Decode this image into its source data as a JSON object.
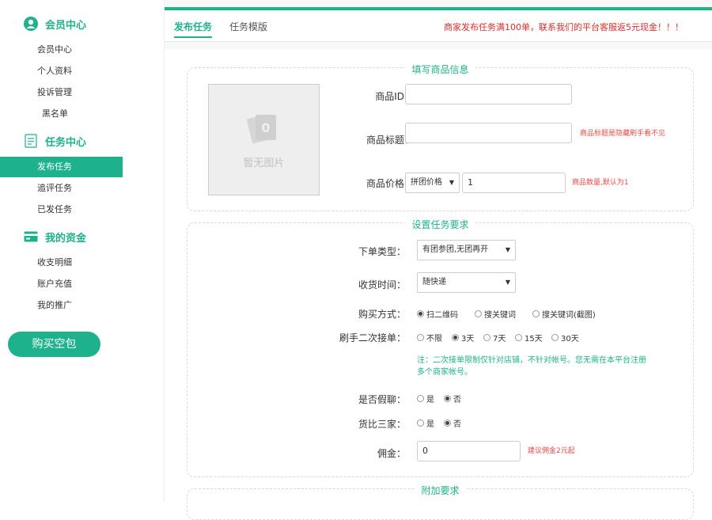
{
  "sidebar": {
    "sections": [
      {
        "title": "会员中心",
        "items": [
          "会员中心",
          "个人资料",
          "投诉管理",
          "黑名单"
        ]
      },
      {
        "title": "任务中心",
        "items": [
          "发布任务",
          "追评任务",
          "已发任务"
        ]
      },
      {
        "title": "我的资金",
        "items": [
          "收支明细",
          "账户充值",
          "我的推广"
        ]
      }
    ],
    "active_item": "发布任务",
    "buy_button": "购买空包"
  },
  "tabs": {
    "publish": "发布任务",
    "template": "任务模版"
  },
  "notice": "商家发布任务满100单，联系我们的平台客服返5元现金！！！",
  "product": {
    "legend": "填写商品信息",
    "no_image": "暂无图片",
    "id_label": "商品ID：",
    "id_value": "",
    "title_label": "商品标题：",
    "title_value": "",
    "title_hint": "商品标题是隐藏刷手看不见",
    "price_label": "商品价格：",
    "price_type": "拼团价格",
    "price_value": "1",
    "price_hint": "商品数量,默认为1"
  },
  "task": {
    "legend": "设置任务要求",
    "order_type_label": "下单类型：",
    "order_type_value": "有团参团,无团再开",
    "receive_label": "收货时间：",
    "receive_value": "随快递",
    "buy_label": "购买方式：",
    "buy_options": [
      "扫二维码",
      "搜关键词",
      "搜关键词(截图)"
    ],
    "buy_selected": 0,
    "second_label": "刷手二次接单：",
    "second_options": [
      "不限",
      "3天",
      "7天",
      "15天",
      "30天"
    ],
    "second_selected": 1,
    "second_note_1": "注：二次接单限制仅针对店铺，不针对帐号。您无需在本平台注册",
    "second_note_2": "多个商家帐号。",
    "fake_chat_label": "是否假聊：",
    "fake_chat_options": [
      "是",
      "否"
    ],
    "fake_chat_selected": 1,
    "compare_label": "货比三家：",
    "compare_options": [
      "是",
      "否"
    ],
    "compare_selected": 1,
    "commission_label": "佣金：",
    "commission_value": "0",
    "commission_hint": "建议佣金2元起"
  },
  "extra": {
    "legend": "附加要求"
  },
  "colors": {
    "accent": "#1db28b",
    "alert": "#e02b2b"
  },
  "icons": [
    "user-icon",
    "task-list-icon",
    "wallet-icon",
    "image-placeholder-icon"
  ]
}
